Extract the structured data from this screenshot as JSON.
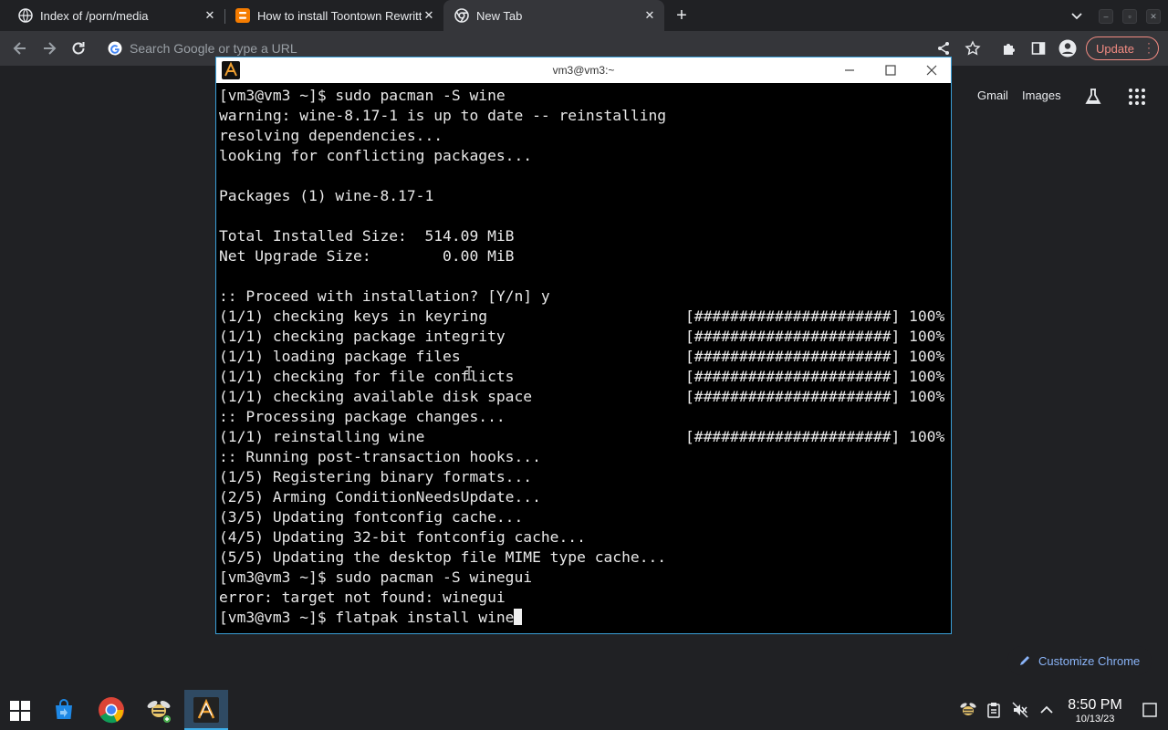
{
  "browser": {
    "tabs": [
      {
        "title": "Index of /porn/media",
        "close": "✕"
      },
      {
        "title": "How to install Toontown Rewritten",
        "close": "✕"
      },
      {
        "title": "New Tab",
        "close": "✕"
      }
    ],
    "new_tab_symbol": "+",
    "window_controls": [
      "–",
      "▫",
      "✕"
    ],
    "omnibox_placeholder": "Search Google or type a URL",
    "update_label": "Update",
    "accent_color": "#f28b82"
  },
  "ntp": {
    "gmail": "Gmail",
    "images": "Images",
    "customize_label": "Customize Chrome"
  },
  "terminal": {
    "title": "vm3@vm3:~",
    "lines": [
      "[vm3@vm3 ~]$ sudo pacman -S wine",
      "warning: wine-8.17-1 is up to date -- reinstalling",
      "resolving dependencies...",
      "looking for conflicting packages...",
      "",
      "Packages (1) wine-8.17-1",
      "",
      "Total Installed Size:  514.09 MiB",
      "Net Upgrade Size:        0.00 MiB",
      "",
      ":: Proceed with installation? [Y/n] y",
      "(1/1) checking keys in keyring",
      "(1/1) checking package integrity",
      "(1/1) loading package files",
      "(1/1) checking for file conflicts",
      "(1/1) checking available disk space",
      ":: Processing package changes...",
      "(1/1) reinstalling wine",
      ":: Running post-transaction hooks...",
      "(1/5) Registering binary formats...",
      "(2/5) Arming ConditionNeedsUpdate...",
      "(3/5) Updating fontconfig cache...",
      "(4/5) Updating 32-bit fontconfig cache...",
      "(5/5) Updating the desktop file MIME type cache...",
      "[vm3@vm3 ~]$ sudo pacman -S winegui",
      "error: target not found: winegui",
      "[vm3@vm3 ~]$ flatpak install wine"
    ],
    "progress_text": "[######################] 100%",
    "progress": {
      "11": "[######################] 100%",
      "12": "[######################] 100%",
      "13": "[######################] 100%",
      "14": "[######################] 100%",
      "15": "[######################] 100%",
      "17": "[######################] 100%"
    },
    "border_color": "#3a9fd8"
  },
  "taskbar": {
    "apps": [
      "store-icon",
      "chrome-icon",
      "wine-icon",
      "terminal-icon"
    ],
    "active_app": "terminal-icon",
    "clock_time": "8:50 PM",
    "clock_date": "10/13/23"
  }
}
